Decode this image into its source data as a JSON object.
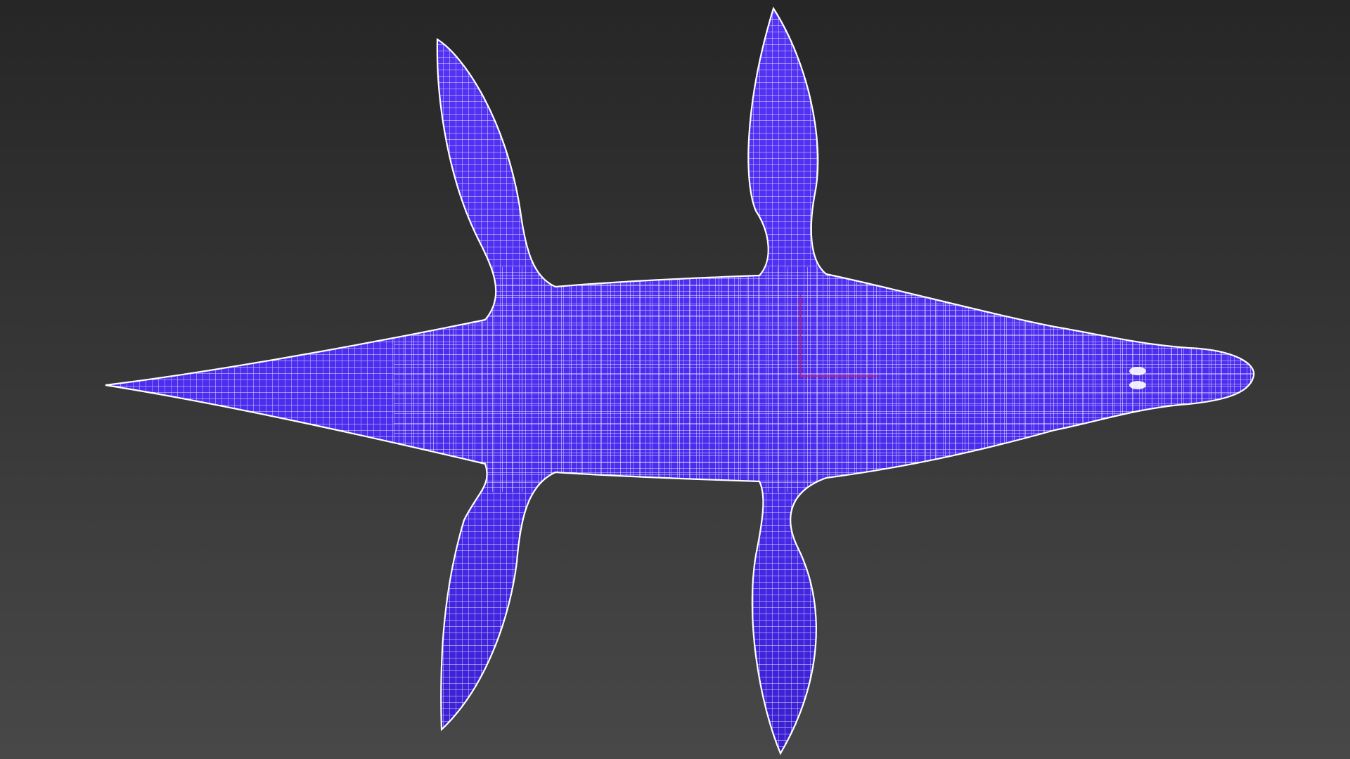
{
  "viewport": {
    "mode": "wireframe-on-shaded",
    "view": "top",
    "background": {
      "top_color": "#262626",
      "bottom_color": "#484848"
    },
    "model": {
      "name": "plesiosaur-mesh",
      "shaded_color": "#4c2cf2",
      "shadow_color": "#2e14b8",
      "wire_color": "#ffffff"
    },
    "gizmo": {
      "x_axis_color": "#d0206a",
      "y_axis_color": "#c81864"
    }
  }
}
